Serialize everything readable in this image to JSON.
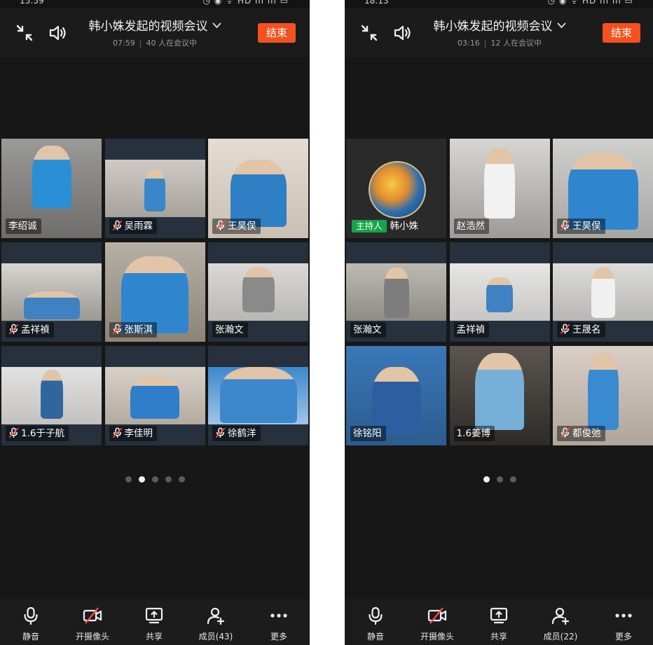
{
  "colors": {
    "background": "#171717",
    "end_button": "#f4511e",
    "host_badge": "#16a34a",
    "tile_background": "#26313d"
  },
  "screens": [
    {
      "status_time": "15:59",
      "status_indicators": "◷ ◉ ᯤ HD ıll ıll ▭",
      "meeting_title": "韩小姝发起的视频会议",
      "elapsed": "07:59",
      "participants_summary": "40 人在会议中",
      "end_button": "结束",
      "tiles": [
        {
          "name": "李绍诚",
          "muted": false
        },
        {
          "name": "吴雨霖",
          "muted": true
        },
        {
          "name": "王昊俣",
          "muted": true
        },
        {
          "name": "孟祥禎",
          "muted": true
        },
        {
          "name": "张斯淇",
          "muted": true
        },
        {
          "name": "张瀚文",
          "muted": false
        },
        {
          "name": "1.6于子航",
          "muted": true
        },
        {
          "name": "李佳明",
          "muted": true
        },
        {
          "name": "徐鹤洋",
          "muted": true
        }
      ],
      "pages": 5,
      "active_page": 1,
      "toolbar": {
        "mute": "静音",
        "camera": "开摄像头",
        "share": "共享",
        "members": "成员(43)",
        "more": "更多"
      }
    },
    {
      "status_time": "18:13",
      "status_indicators": "◷ ◉ ᯤ HD ıll ıll ▭",
      "meeting_title": "韩小姝发起的视频会议",
      "elapsed": "03:16",
      "participants_summary": "12 人在会议中",
      "end_button": "结束",
      "tiles": [
        {
          "name": "韩小姝",
          "muted": false,
          "host_label": "主持人"
        },
        {
          "name": "赵浩然",
          "muted": false
        },
        {
          "name": "王昊俣",
          "muted": true
        },
        {
          "name": "张瀚文",
          "muted": false
        },
        {
          "name": "孟祥禎",
          "muted": false
        },
        {
          "name": "王晟名",
          "muted": true
        },
        {
          "name": "徐铭阳",
          "muted": false
        },
        {
          "name": "1.6姜博",
          "muted": false
        },
        {
          "name": "都俊弛",
          "muted": true
        }
      ],
      "pages": 3,
      "active_page": 0,
      "toolbar": {
        "mute": "静音",
        "camera": "开摄像头",
        "share": "共享",
        "members": "成员(22)",
        "more": "更多"
      }
    }
  ]
}
